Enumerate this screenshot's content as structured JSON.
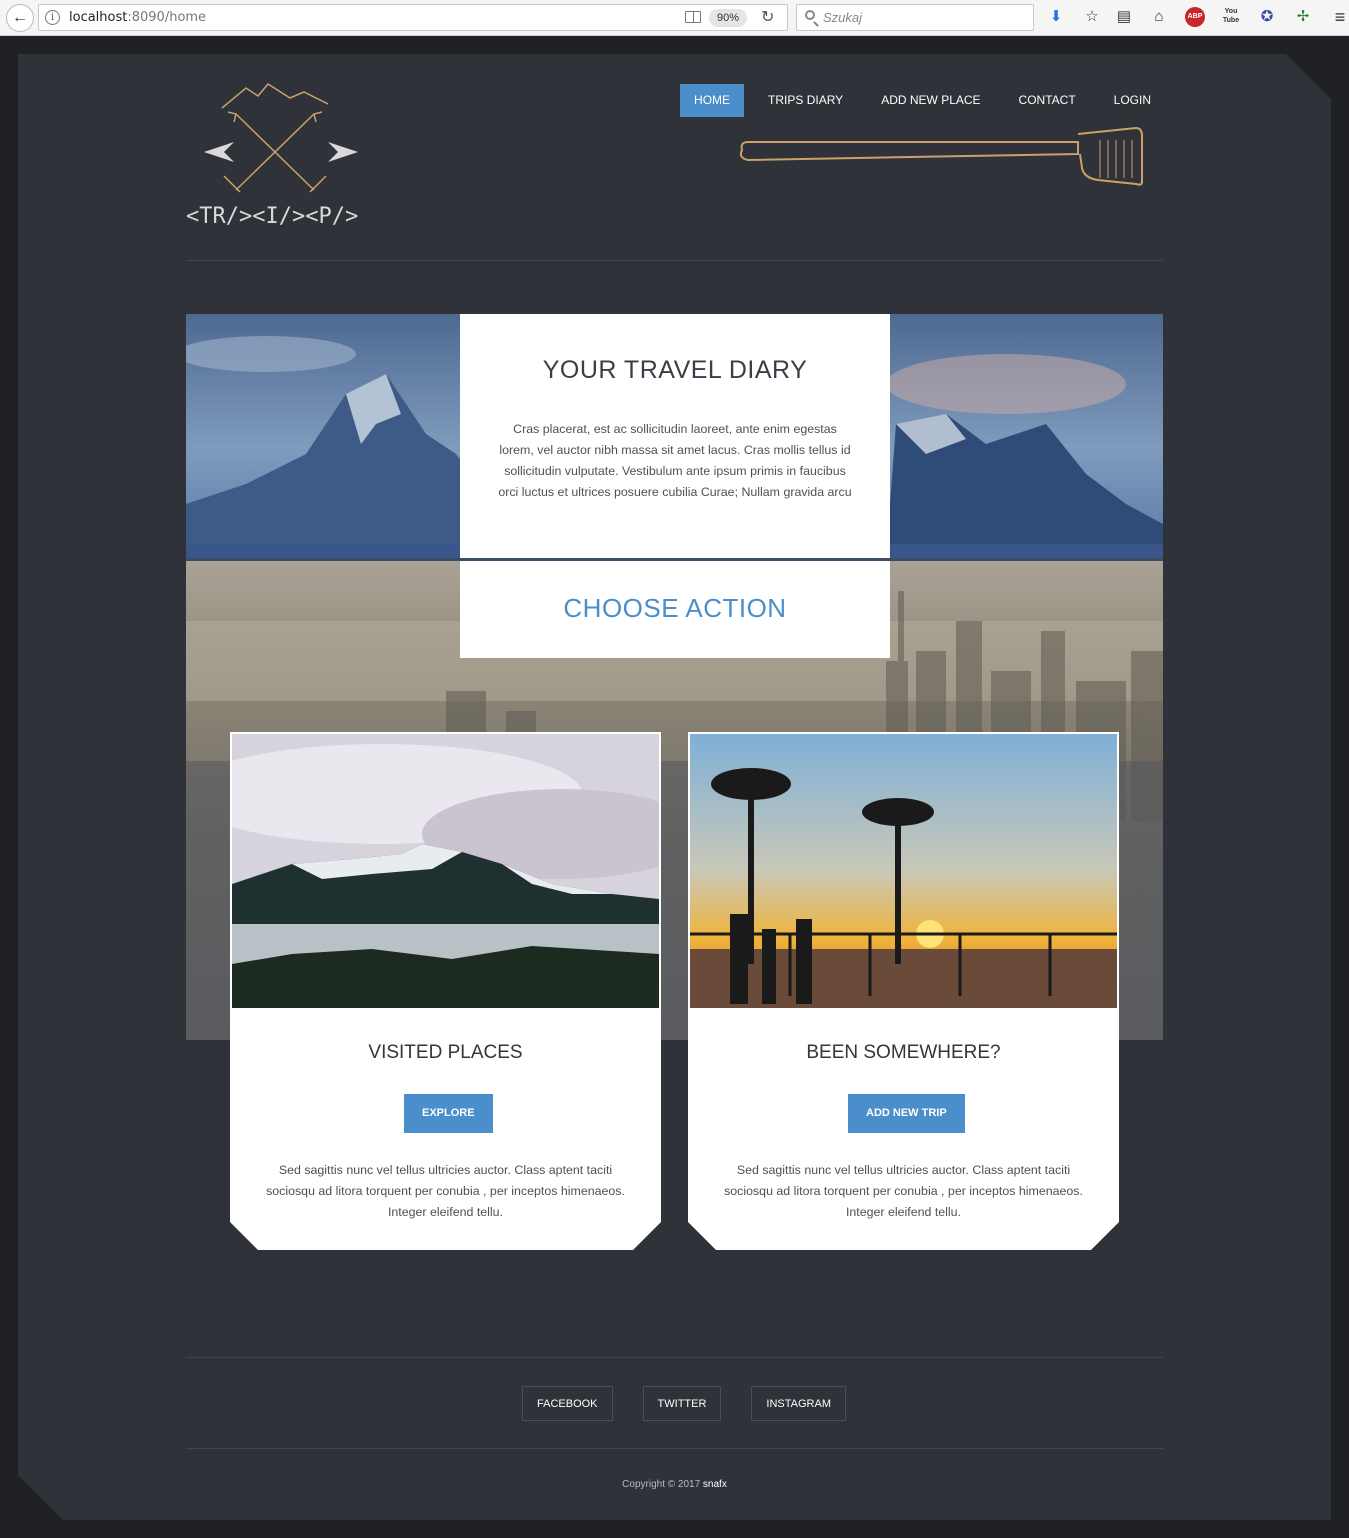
{
  "browser": {
    "url_host": "localhost",
    "url_path": ":8090/home",
    "zoom": "90%",
    "search_placeholder": "Szukaj",
    "youtube_label": "You Tube",
    "abp_label": "ABP"
  },
  "logo": {
    "text": "<TR/><I/><P/>"
  },
  "nav": {
    "items": [
      "HOME",
      "TRIPS DIARY",
      "ADD NEW PLACE",
      "CONTACT",
      "LOGIN"
    ],
    "active": "HOME"
  },
  "hero": {
    "title": "YOUR TRAVEL DIARY",
    "text": "Cras placerat, est ac sollicitudin laoreet, ante enim egestas lorem, vel auctor nibh massa sit amet lacus. Cras mollis tellus id sollicitudin vulputate. Vestibulum ante ipsum primis in faucibus orci luctus et ultrices posuere cubilia Curae; Nullam gravida arcu"
  },
  "choose_action": {
    "title": "CHOOSE ACTION"
  },
  "cards": [
    {
      "title": "VISITED PLACES",
      "button": "EXPLORE",
      "text": "Sed sagittis nunc vel tellus ultricies auctor. Class aptent taciti sociosqu ad litora torquent per conubia , per inceptos himenaeos. Integer eleifend tellu."
    },
    {
      "title": "BEEN SOMEWHERE?",
      "button": "ADD NEW TRIP",
      "text": "Sed sagittis nunc vel tellus ultricies auctor. Class aptent taciti sociosqu ad litora torquent per conubia , per inceptos himenaeos. Integer eleifend tellu."
    }
  ],
  "footer": {
    "social": [
      "FACEBOOK",
      "TWITTER",
      "INSTAGRAM"
    ],
    "copyright": "Copyright © 2017 ",
    "author": "snafx"
  },
  "colors": {
    "accent": "#4a8fcc",
    "page_bg": "#2f3238",
    "outer_bg": "#1f2125",
    "logo_gold": "#c8a26a"
  }
}
